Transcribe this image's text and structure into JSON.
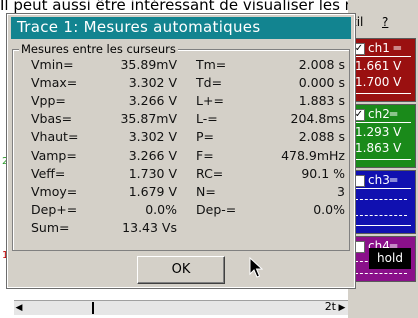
{
  "background": {
    "caption": "Il peut aussi être intéressant de visualiser les mesures (il y a notamment les temps de descente et de montée (T- et T+) pour lesquels il peut être intéressant de vérifier les performances de l'AOP). Le sigal de sortie de l'AOP. On peut aussi en profiter pour regarder les mesures sur ce signal. Pour info il y a eu une fois un composant Pas de lien fourni. ",
    "tick_2": "2",
    "tick_1": "1"
  },
  "menu": {
    "outil": "til",
    "help": "?"
  },
  "channels": [
    {
      "name": "ch1",
      "checked": true,
      "v1": "1.661 V",
      "v2": "1.700 V",
      "color": "#9a1010"
    },
    {
      "name": "ch2",
      "checked": true,
      "v1": "1.293 V",
      "v2": "1.863 V",
      "color": "#1a8a1a"
    },
    {
      "name": "ch3",
      "checked": false,
      "v1": "",
      "v2": "",
      "color": "#1010b0"
    },
    {
      "name": "ch4",
      "checked": false,
      "v1": "",
      "v2": "",
      "color": "#8a108a"
    }
  ],
  "hold_label": "hold",
  "dialog": {
    "title": "Trace 1: Mesures automatiques",
    "group_caption": "Mesures entre les curseurs",
    "measurements_left": [
      {
        "label": "Vmin=",
        "value": "35.89mV"
      },
      {
        "label": "Vmax=",
        "value": "3.302 V"
      },
      {
        "label": "Vpp=",
        "value": "3.266 V"
      },
      {
        "label": "Vbas=",
        "value": "35.87mV"
      },
      {
        "label": "Vhaut=",
        "value": "3.302 V"
      },
      {
        "label": "Vamp=",
        "value": "3.266 V"
      },
      {
        "label": "Veff=",
        "value": "1.730 V"
      },
      {
        "label": "Vmoy=",
        "value": "1.679 V"
      },
      {
        "label": "Dep+=",
        "value": "0.0%"
      },
      {
        "label": "Sum=",
        "value": "13.43 Vs"
      }
    ],
    "measurements_right": [
      {
        "label": "Tm=",
        "value": "2.008 s"
      },
      {
        "label": "Td=",
        "value": "0.000 s"
      },
      {
        "label": "L+=",
        "value": "1.883 s"
      },
      {
        "label": "L-=",
        "value": "204.8ms"
      },
      {
        "label": "P=",
        "value": "2.088 s"
      },
      {
        "label": "F=",
        "value": "478.9mHz"
      },
      {
        "label": "RC=",
        "value": "90.1 %"
      },
      {
        "label": "N=",
        "value": "3"
      },
      {
        "label": "Dep-=",
        "value": "0.0%"
      }
    ],
    "ok_label": "OK"
  },
  "scrollbar": {
    "mark": "2t"
  },
  "colors": {
    "title_bar": "#128490",
    "dialog_bg": "#d4d0c8"
  }
}
